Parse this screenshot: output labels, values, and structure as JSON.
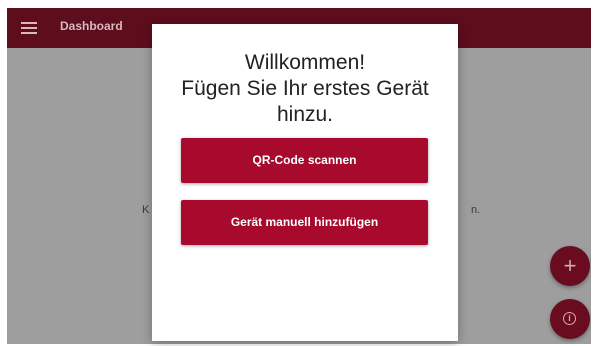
{
  "app_bar": {
    "title": "Dashboard",
    "menu_icon": "menu-icon"
  },
  "background": {
    "text_left": "K",
    "text_right": "n."
  },
  "fabs": {
    "add_symbol": "+",
    "add_icon": "plus-icon",
    "info_symbol": "i",
    "info_icon": "info-icon"
  },
  "dialog": {
    "title_line1": "Willkommen!",
    "title_line2": "Fügen Sie Ihr erstes Gerät",
    "title_line3": "hinzu.",
    "qr_button": "QR-Code scannen",
    "manual_button": "Gerät manuell hinzufügen"
  },
  "colors": {
    "app_bar": "#5e0d1d",
    "primary_button": "#a80a2d",
    "overlay": "#9e9e9e"
  }
}
